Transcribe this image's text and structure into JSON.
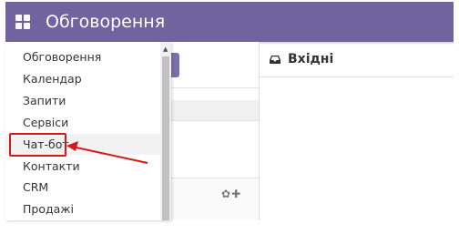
{
  "header": {
    "app_icon": "apps-grid-icon",
    "title": "Обговорення"
  },
  "dropdown": {
    "items": [
      {
        "label": "Обговорення"
      },
      {
        "label": "Календар"
      },
      {
        "label": "Запити"
      },
      {
        "label": "Сервіси"
      },
      {
        "label": "Чат-бот",
        "highlighted": true
      },
      {
        "label": "Контакти"
      },
      {
        "label": "CRM"
      },
      {
        "label": "Продажі"
      }
    ],
    "scroll_up_icon": "caret-up-icon"
  },
  "sidebar": {
    "settings_icon": "gear-icon",
    "add_icon": "plus-icon"
  },
  "inbox": {
    "icon": "inbox-icon",
    "title": "Вхідні"
  },
  "annotation": {
    "color": "#d11a1a",
    "target": "Чат-бот"
  },
  "colors": {
    "header_bg": "#71639e",
    "accent": "#7c6ea8"
  }
}
